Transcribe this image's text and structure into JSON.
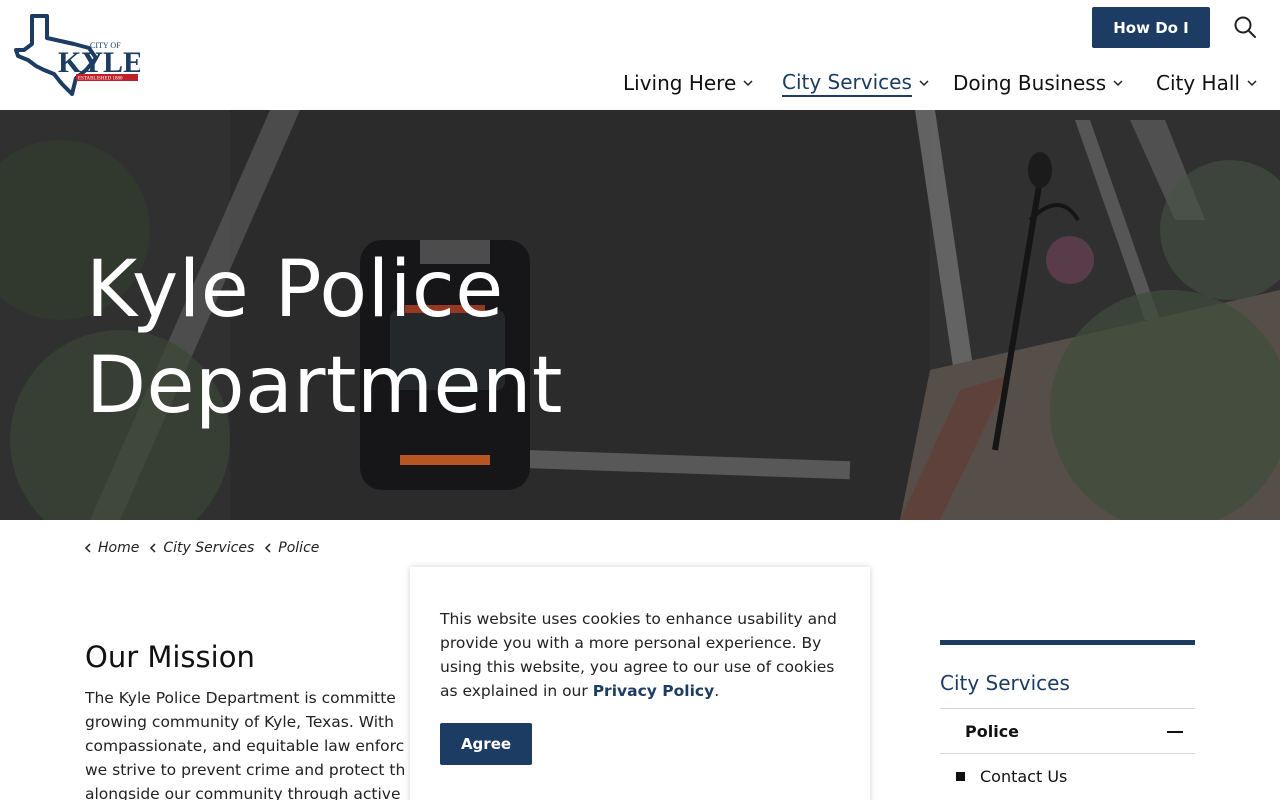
{
  "header": {
    "logo_text": "CITY OF KYLE",
    "logo_established": "ESTABLISHED 1880",
    "how_do_i": "How Do I",
    "search_icon": "search-icon",
    "nav": [
      {
        "label": "Living Here"
      },
      {
        "label": "City Services",
        "active": true
      },
      {
        "label": "Doing Business"
      },
      {
        "label": "City Hall"
      }
    ],
    "brand_color": "#1d3c63"
  },
  "hero": {
    "title_line1": "Kyle Police",
    "title_line2": "Department"
  },
  "breadcrumb": [
    {
      "label": "Home"
    },
    {
      "label": "City Services"
    },
    {
      "label": "Police"
    }
  ],
  "mission": {
    "title": "Our Mission",
    "lines": [
      "The Kyle Police Department is committe",
      "growing community of Kyle, Texas. With",
      "compassionate, and equitable law enforc",
      "we strive to prevent crime and protect th",
      "alongside our community through active"
    ]
  },
  "cookie": {
    "text_before": "This website uses cookies to enhance usability and provide you with a more personal experience. By using this website, you agree to our use of cookies as explained in our ",
    "link": "Privacy Policy",
    "text_after": ".",
    "agree_label": "Agree"
  },
  "sidebar": {
    "title": "City Services",
    "items": [
      {
        "label": "Police"
      },
      {
        "label": "Contact Us"
      }
    ]
  }
}
